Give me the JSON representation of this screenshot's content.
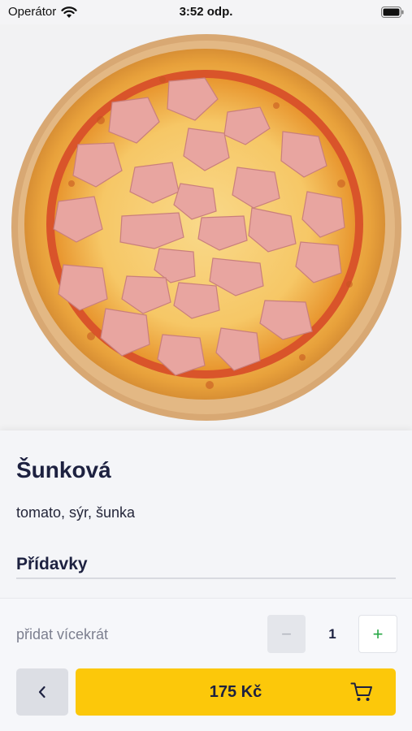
{
  "status_bar": {
    "carrier": "Operátor",
    "time": "3:52 odp."
  },
  "product": {
    "name": "Šunková",
    "ingredients": "tomato, sýr, šunka",
    "image_icon": "pizza-photo"
  },
  "extras": {
    "title": "Přídavky"
  },
  "quantity": {
    "label": "přidat vícekrát",
    "minus": "−",
    "value": "1",
    "plus": "+"
  },
  "actions": {
    "back_icon": "chevron-left-icon",
    "price": "175 Kč",
    "cart_icon": "cart-icon"
  },
  "colors": {
    "accent_yellow": "#fcc80a",
    "title_navy": "#1d2140",
    "plus_green": "#27a845"
  }
}
